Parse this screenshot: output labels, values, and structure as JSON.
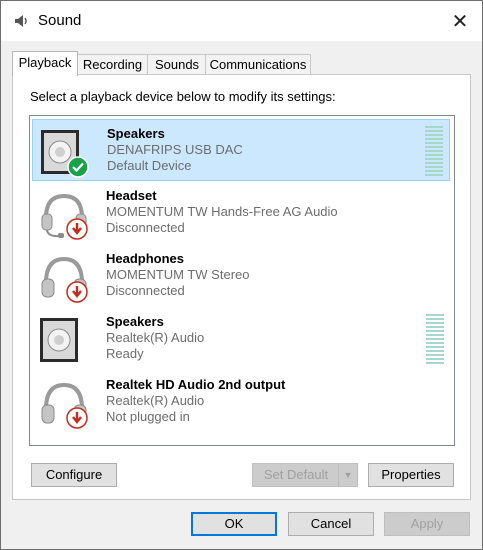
{
  "window": {
    "title": "Sound",
    "close_glyph": "✕"
  },
  "tabs": [
    {
      "label": "Playback",
      "active": true
    },
    {
      "label": "Recording",
      "active": false
    },
    {
      "label": "Sounds",
      "active": false
    },
    {
      "label": "Communications",
      "active": false
    }
  ],
  "instruction": "Select a playback device below to modify its settings:",
  "devices": [
    {
      "name": "Speakers",
      "description": "DENAFRIPS USB DAC",
      "status": "Default Device",
      "icon": "speaker-icon",
      "badge": "default-check-icon",
      "selected": true,
      "level_meter": true
    },
    {
      "name": "Headset",
      "description": "MOMENTUM TW Hands-Free AG Audio",
      "status": "Disconnected",
      "icon": "headset-icon",
      "badge": "disconnected-arrow-icon",
      "selected": false,
      "level_meter": false
    },
    {
      "name": "Headphones",
      "description": "MOMENTUM TW Stereo",
      "status": "Disconnected",
      "icon": "headphones-icon",
      "badge": "disconnected-arrow-icon",
      "selected": false,
      "level_meter": false
    },
    {
      "name": "Speakers",
      "description": "Realtek(R) Audio",
      "status": "Ready",
      "icon": "speaker-icon",
      "badge": "",
      "selected": false,
      "level_meter": true
    },
    {
      "name": "Realtek HD Audio 2nd output",
      "description": "Realtek(R) Audio",
      "status": "Not plugged in",
      "icon": "headphones-icon",
      "badge": "unplugged-arrow-icon",
      "selected": false,
      "level_meter": false
    }
  ],
  "buttons": {
    "configure": "Configure",
    "set_default": "Set Default",
    "properties": "Properties",
    "ok": "OK",
    "cancel": "Cancel",
    "apply": "Apply"
  },
  "colors": {
    "selection_bg": "#cce8ff",
    "check_badge": "#16a34a",
    "disconnect_badge": "#c42b1c",
    "meter": "#a6d6ce"
  }
}
